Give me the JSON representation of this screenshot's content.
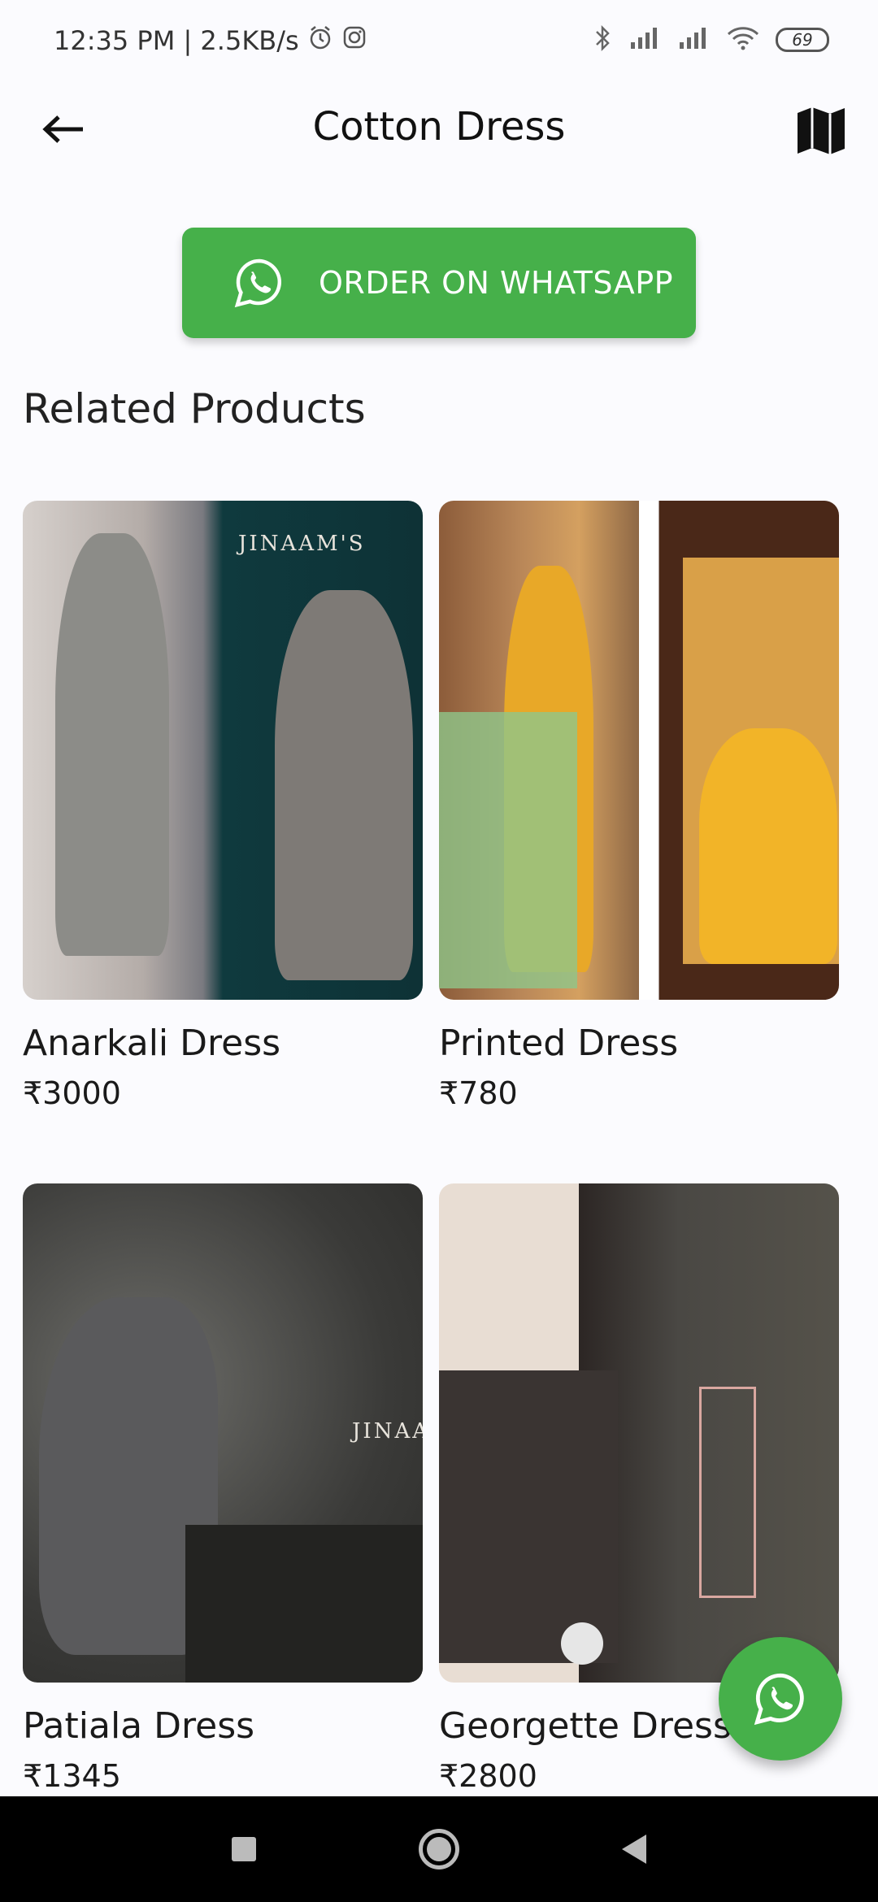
{
  "status_bar": {
    "time_speed": "12:35 PM | 2.5KB/s",
    "battery": "69"
  },
  "app_bar": {
    "title": "Cotton Dress",
    "back_icon": "arrow-left-icon",
    "map_icon": "map-icon"
  },
  "order_button": {
    "label": "ORDER ON WHATSAPP",
    "icon": "whatsapp-icon",
    "color": "#46b04a"
  },
  "related": {
    "title": "Related Products",
    "products": [
      {
        "name": "Anarkali Dress",
        "price": "₹3000"
      },
      {
        "name": "Printed Dress",
        "price": "₹780"
      },
      {
        "name": "Patiala Dress",
        "price": "₹1345"
      },
      {
        "name": "Georgette Dress",
        "price": "₹2800"
      }
    ],
    "brand_marks": [
      "JINAAM'S",
      "JINAAM'S"
    ]
  },
  "fab": {
    "icon": "whatsapp-icon",
    "color": "#46b04a"
  }
}
